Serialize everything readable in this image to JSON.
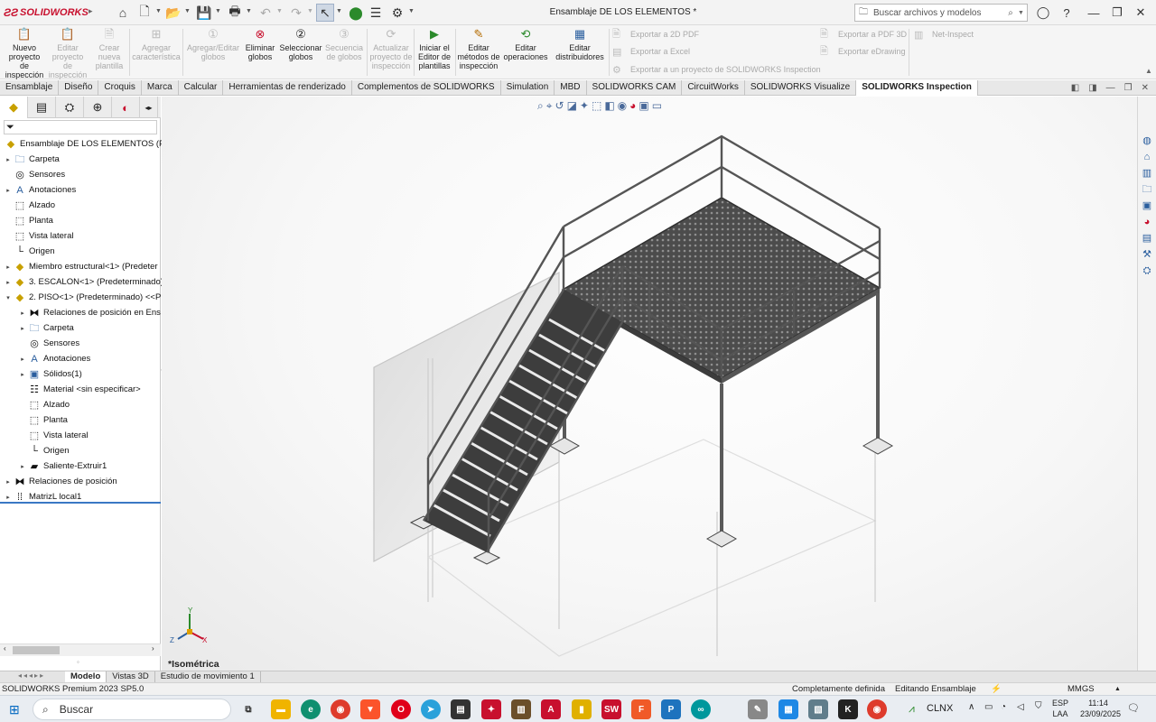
{
  "titlebar": {
    "brand": "SOLIDWORKS",
    "document_title": "Ensamblaje DE LOS ELEMENTOS *",
    "search_placeholder": "Buscar archivos y modelos"
  },
  "ribbon": {
    "buttons": [
      {
        "label": "Nuevo proyecto de inspección",
        "enabled": true
      },
      {
        "label": "Editar proyecto de inspección",
        "enabled": false
      },
      {
        "label": "Crear nueva plantilla",
        "enabled": false
      },
      {
        "label": "Agregar característica",
        "enabled": false
      },
      {
        "label": "Agregar/Editar globos",
        "enabled": false
      },
      {
        "label": "Eliminar globos",
        "enabled": true
      },
      {
        "label": "Seleccionar globos",
        "enabled": true
      },
      {
        "label": "Secuencia de globos",
        "enabled": false
      },
      {
        "label": "Actualizar proyecto de inspección",
        "enabled": false
      },
      {
        "label": "Iniciar el Editor de plantillas",
        "enabled": true
      },
      {
        "label": "Editar métodos de inspección",
        "enabled": true
      },
      {
        "label": "Editar operaciones",
        "enabled": true
      },
      {
        "label": "Editar distribuidores",
        "enabled": true
      }
    ],
    "export": {
      "pdf2d": "Exportar a 2D PDF",
      "excel": "Exportar a Excel",
      "inspection": "Exportar a un proyecto de SOLIDWORKS Inspection",
      "pdf3d": "Exportar a PDF 3D",
      "edrawing": "Exportar eDrawing",
      "netinspect": "Net-Inspect"
    }
  },
  "tabs": [
    "Ensamblaje",
    "Diseño",
    "Croquis",
    "Marca",
    "Calcular",
    "Herramientas de renderizado",
    "Complementos de SOLIDWORKS",
    "Simulation",
    "MBD",
    "SOLIDWORKS CAM",
    "CircuitWorks",
    "SOLIDWORKS Visualize",
    "SOLIDWORKS Inspection"
  ],
  "active_tab": "SOLIDWORKS Inspection",
  "tree": {
    "root": "Ensamblaje DE LOS ELEMENTOS (Prede",
    "items": [
      {
        "label": "Carpeta",
        "icon": "folder-icon",
        "level": 1
      },
      {
        "label": "Sensores",
        "icon": "sensor-icon",
        "level": 1
      },
      {
        "label": "Anotaciones",
        "icon": "annotation-icon",
        "level": 1
      },
      {
        "label": "Alzado",
        "icon": "plane-icon",
        "level": 1
      },
      {
        "label": "Planta",
        "icon": "plane-icon",
        "level": 1
      },
      {
        "label": "Vista lateral",
        "icon": "plane-icon",
        "level": 1
      },
      {
        "label": "Origen",
        "icon": "origin-icon",
        "level": 1
      },
      {
        "label": "Miembro estructural<1> (Predeter",
        "icon": "part-icon",
        "level": 1
      },
      {
        "label": "3. ESCALON<1> (Predeterminado)",
        "icon": "part-icon",
        "level": 1
      },
      {
        "label": "2. PISO<1> (Predeterminado) <<P",
        "icon": "part-icon",
        "level": 1
      },
      {
        "label": "Relaciones de posición en Ens",
        "icon": "mate-icon",
        "level": 2
      },
      {
        "label": "Carpeta",
        "icon": "folder-icon",
        "level": 2
      },
      {
        "label": "Sensores",
        "icon": "sensor-icon",
        "level": 2
      },
      {
        "label": "Anotaciones",
        "icon": "annotation-icon",
        "level": 2
      },
      {
        "label": "Sólidos(1)",
        "icon": "solid-icon",
        "level": 2
      },
      {
        "label": "Material <sin especificar>",
        "icon": "material-icon",
        "level": 2
      },
      {
        "label": "Alzado",
        "icon": "plane-icon",
        "level": 2
      },
      {
        "label": "Planta",
        "icon": "plane-icon",
        "level": 2
      },
      {
        "label": "Vista lateral",
        "icon": "plane-icon",
        "level": 2
      },
      {
        "label": "Origen",
        "icon": "origin-icon",
        "level": 2
      },
      {
        "label": "Saliente-Extruir1",
        "icon": "extrude-icon",
        "level": 2
      },
      {
        "label": "Relaciones de posición",
        "icon": "mate-icon",
        "level": 1
      },
      {
        "label": "MatrizL local1",
        "icon": "pattern-icon",
        "level": 1
      }
    ]
  },
  "bottom_tabs": [
    "Modelo",
    "Vistas 3D",
    "Estudio de movimiento 1"
  ],
  "viewport": {
    "view_name": "*Isométrica",
    "axes": [
      "X",
      "Y",
      "Z"
    ]
  },
  "status": {
    "product": "SOLIDWORKS Premium 2023 SP5.0",
    "definition": "Completamente definida",
    "mode": "Editando Ensamblaje",
    "units": "MMGS"
  },
  "taskbar": {
    "search": "Buscar",
    "tray_label": "CLNX",
    "lang_top": "ESP",
    "lang_bottom": "LAA",
    "time": "11:14",
    "date": "23/09/2025"
  },
  "colors": {
    "brand_red": "#c8102e",
    "accent_blue": "#2a5e9e"
  }
}
